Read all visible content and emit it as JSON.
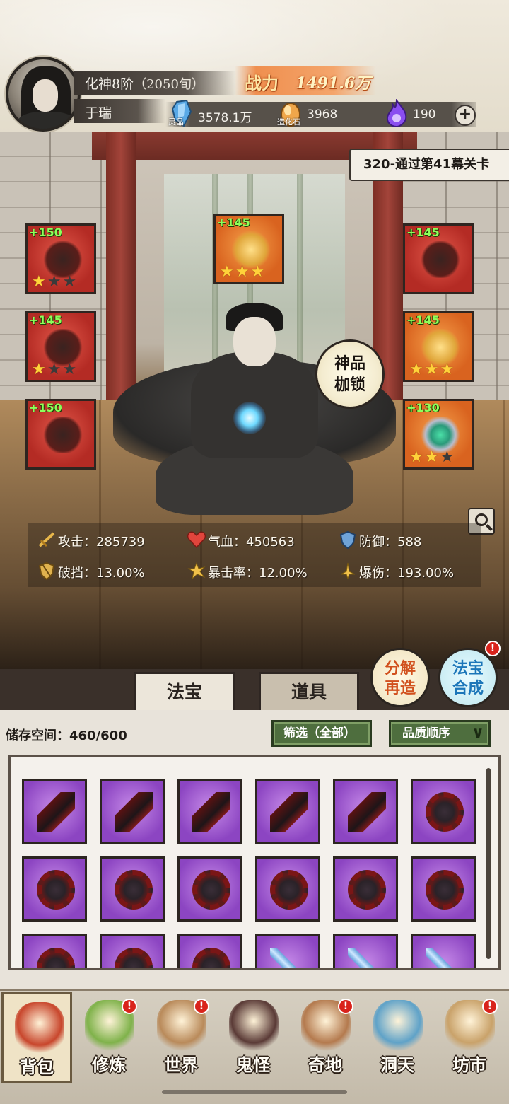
{
  "header": {
    "realm": "化神8阶",
    "age": "（2050旬）",
    "username": "于瑞",
    "power_label": "战力",
    "power_value": "1491.6万",
    "resources": [
      {
        "name": "灵晶",
        "value": "3578.1万",
        "icon": "crystal-icon",
        "color": "#5aa9e6"
      },
      {
        "name": "造化石",
        "value": "3968",
        "icon": "stone-icon",
        "color": "#f0a64a"
      },
      {
        "name": "",
        "value": "190",
        "icon": "purple-flame-icon",
        "color": "#8a4ef0"
      }
    ]
  },
  "stage": {
    "banner": "320-通过第41幕关卡",
    "divine_button": [
      "神品",
      "枷锁"
    ]
  },
  "equipment": [
    {
      "slot": "weapon",
      "level": "+150",
      "stars": 1,
      "max_stars": 3,
      "quality": "red"
    },
    {
      "slot": "crown",
      "level": "+145",
      "stars": 3,
      "max_stars": 3,
      "quality": "gold"
    },
    {
      "slot": "headband",
      "level": "+145",
      "stars": 0,
      "max_stars": 0,
      "quality": "red"
    },
    {
      "slot": "armor",
      "level": "+145",
      "stars": 1,
      "max_stars": 3,
      "quality": "red"
    },
    {
      "slot": "amulet",
      "level": "+145",
      "stars": 3,
      "max_stars": 3,
      "quality": "gold"
    },
    {
      "slot": "boots",
      "level": "+150",
      "stars": 0,
      "max_stars": 0,
      "quality": "red"
    },
    {
      "slot": "ring",
      "level": "+130",
      "stars": 2,
      "max_stars": 3,
      "quality": "gold"
    }
  ],
  "stats": {
    "attack": "攻击：285739",
    "hp": "气血：450563",
    "defense": "防御：588",
    "break": "破挡：13.00%",
    "crit_rate": "暴击率：12.00%",
    "crit_damage": "爆伤：193.00%"
  },
  "side_buttons": {
    "decompose": [
      "分解",
      "再造"
    ],
    "combine": [
      "法宝",
      "合成"
    ],
    "badge": "!"
  },
  "tabs": [
    "法宝",
    "道具"
  ],
  "inventory": {
    "storage": "储存空间：460/600",
    "filter": "筛选（全部）",
    "sort": "品质顺序",
    "items": [
      "dagger",
      "dagger",
      "dagger",
      "dagger",
      "dagger",
      "wheel",
      "wheel",
      "wheel",
      "wheel",
      "wheel",
      "wheel",
      "wheel",
      "wheel",
      "wheel",
      "wheel",
      "blade",
      "blade",
      "blade"
    ]
  },
  "nav": [
    {
      "label": "背包",
      "icon": "backpack-icon",
      "badge": false,
      "color": "#c8462c"
    },
    {
      "label": "修炼",
      "icon": "lotus-icon",
      "badge": true,
      "color": "#7fb24a"
    },
    {
      "label": "世界",
      "icon": "scroll-map-icon",
      "badge": true,
      "color": "#b98a5a"
    },
    {
      "label": "鬼怪",
      "icon": "demon-egg-icon",
      "badge": false,
      "color": "#5a3a36"
    },
    {
      "label": "奇地",
      "icon": "mountain-temple-icon",
      "badge": true,
      "color": "#b47a4e"
    },
    {
      "label": "洞天",
      "icon": "portal-icon",
      "badge": false,
      "color": "#5fa2c8"
    },
    {
      "label": "坊市",
      "icon": "market-cart-icon",
      "badge": true,
      "color": "#c9a26a"
    }
  ]
}
